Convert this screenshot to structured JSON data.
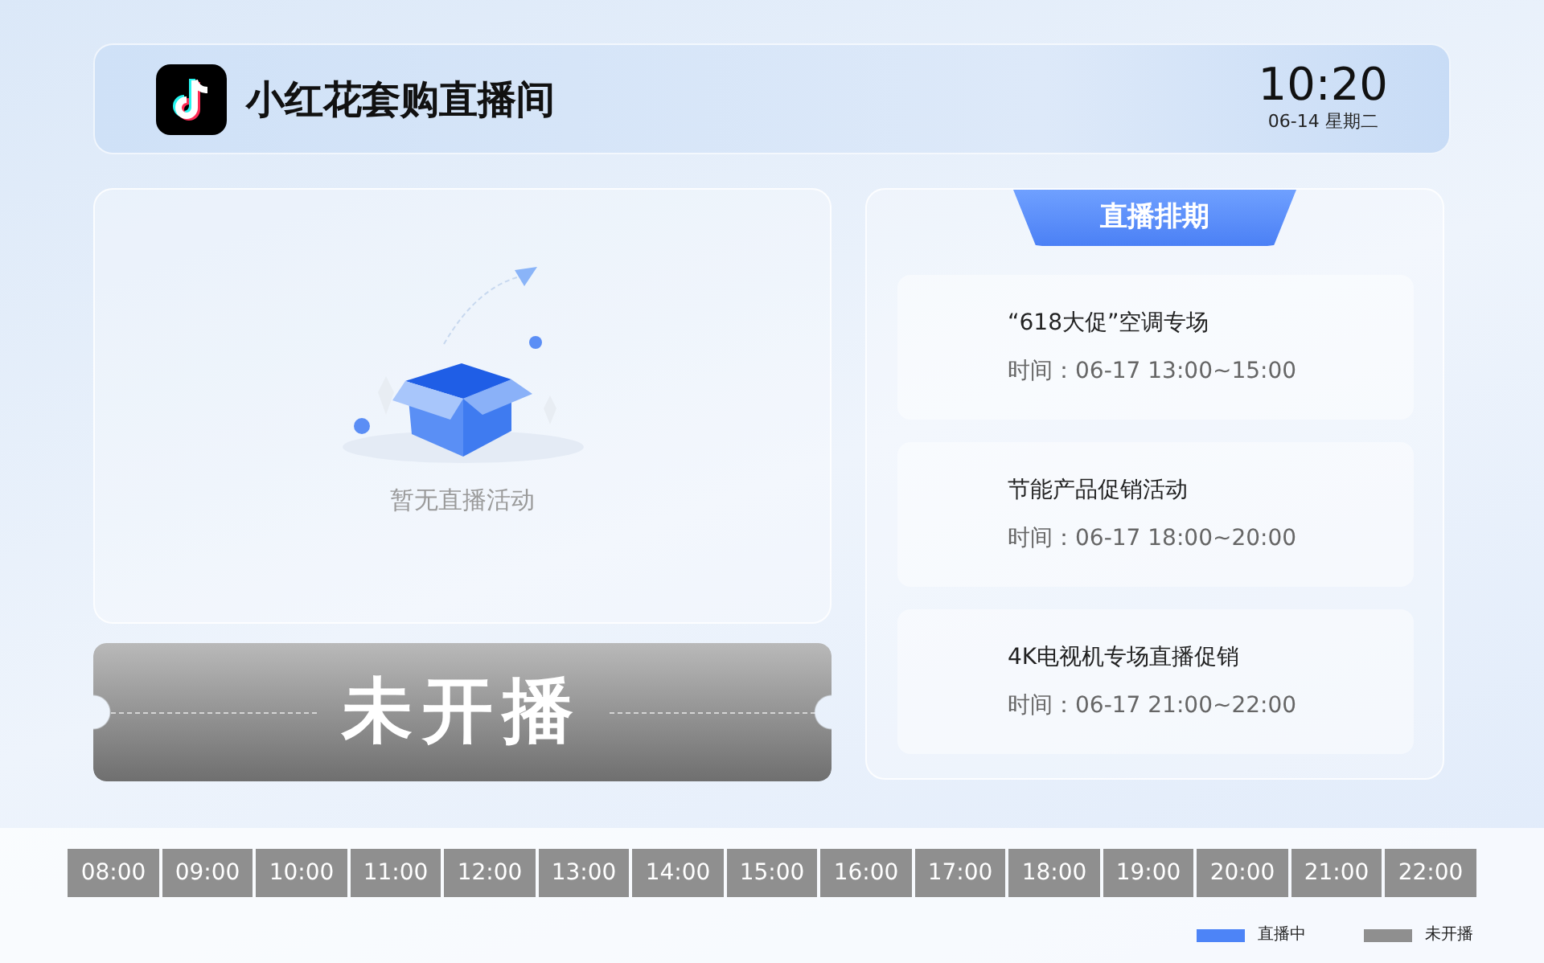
{
  "header": {
    "title": "小红花套购直播间",
    "time": "10:20",
    "date": "06-14 星期二"
  },
  "live_panel": {
    "empty_text": "暂无直播活动",
    "status": {
      "label": "未开播",
      "live": false
    }
  },
  "schedule": {
    "title": "直播排期",
    "items": [
      {
        "name": "“618大促”空调专场",
        "time": "时间：06-17 13:00~15:00"
      },
      {
        "name": "节能产品促销活动",
        "time": "时间：06-17 18:00~20:00"
      },
      {
        "name": "4K电视机专场直播促销",
        "time": "时间：06-17 21:00~22:00"
      }
    ]
  },
  "timeline": [
    {
      "label": "08:00",
      "live": false
    },
    {
      "label": "09:00",
      "live": false
    },
    {
      "label": "10:00",
      "live": false
    },
    {
      "label": "11:00",
      "live": false
    },
    {
      "label": "12:00",
      "live": false
    },
    {
      "label": "13:00",
      "live": false
    },
    {
      "label": "14:00",
      "live": false
    },
    {
      "label": "15:00",
      "live": false
    },
    {
      "label": "16:00",
      "live": false
    },
    {
      "label": "17:00",
      "live": false
    },
    {
      "label": "18:00",
      "live": false
    },
    {
      "label": "19:00",
      "live": false
    },
    {
      "label": "20:00",
      "live": false
    },
    {
      "label": "21:00",
      "live": false
    },
    {
      "label": "22:00",
      "live": false
    }
  ],
  "legend": [
    {
      "label": "直播中",
      "color": "#4d84f7"
    },
    {
      "label": "未开播",
      "color": "#8f8f8f"
    }
  ]
}
